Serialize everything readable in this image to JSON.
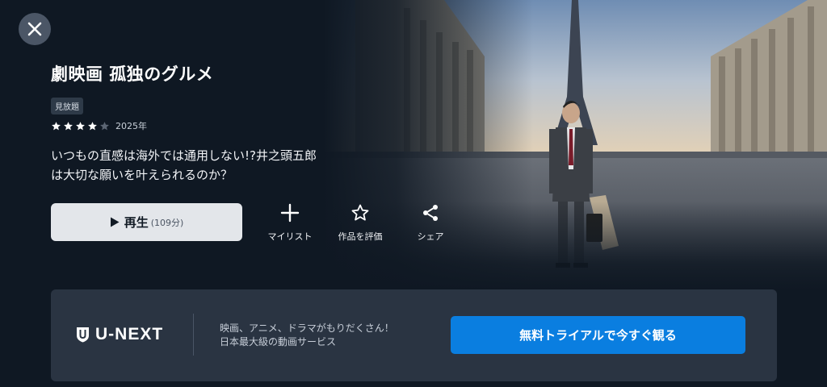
{
  "header": {
    "close_icon": "close-icon"
  },
  "movie": {
    "title": "劇映画 孤独のグルメ",
    "badge": "見放題",
    "rating_stars": 4,
    "rating_max": 5,
    "year": "2025年",
    "synopsis": "いつもの直感は海外では通用しない!?井之頭五郎は大切な願いを叶えられるのか？"
  },
  "play": {
    "icon": "play-icon",
    "label": "再生",
    "duration": "(109分)"
  },
  "actions": [
    {
      "icon": "plus-icon",
      "label": "マイリスト"
    },
    {
      "icon": "star-outline-icon",
      "label": "作品を評価"
    },
    {
      "icon": "share-icon",
      "label": "シェア"
    }
  ],
  "promo": {
    "logo_text": "U-NEXT",
    "line1": "映画、アニメ、ドラマがもりだくさん！",
    "line2": "日本最大級の動画サービス",
    "cta_label": "無料トライアルで今すぐ観る",
    "cta_color": "#0a7ee0"
  }
}
